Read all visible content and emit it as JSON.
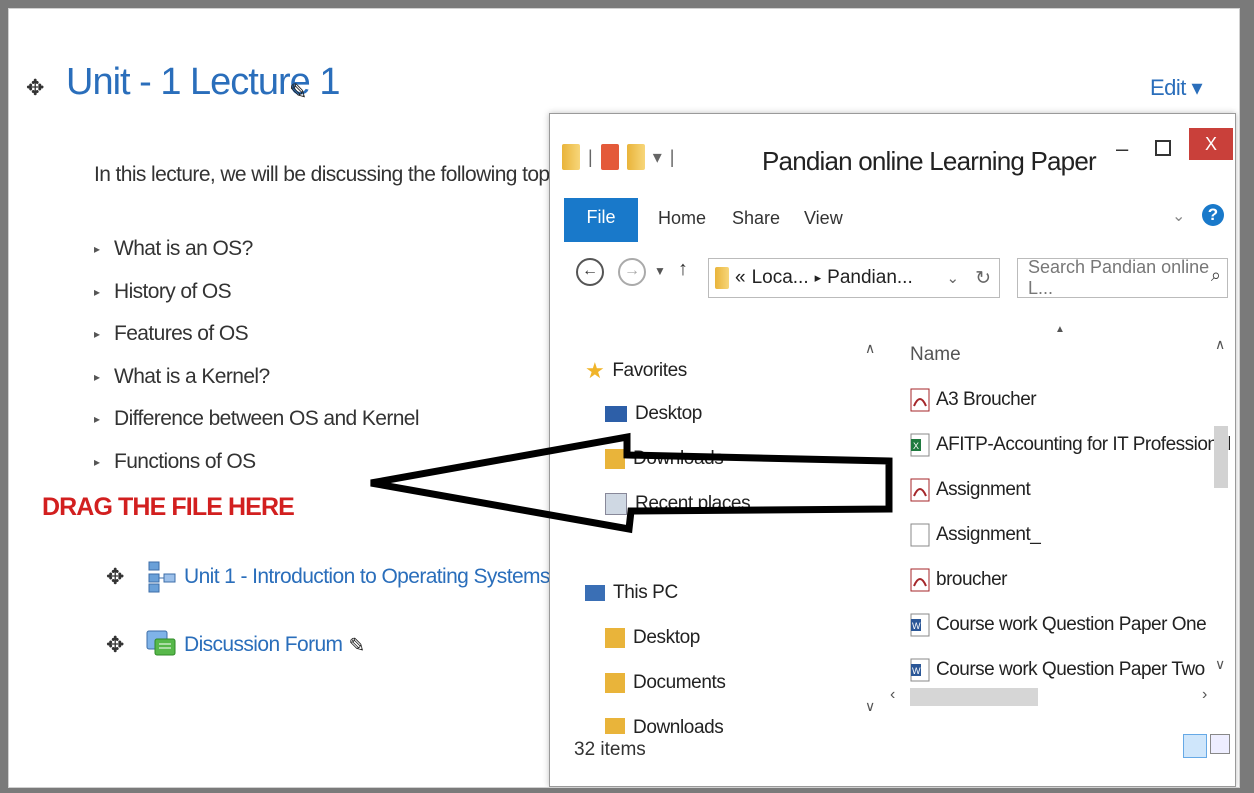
{
  "course": {
    "title": "Unit - 1 Lecture 1",
    "edit_label": "Edit ▾",
    "intro": "In this lecture, we will be discussing the following topics.",
    "topics": [
      "What is an OS?",
      "History of OS",
      "Features of OS",
      "What is a Kernel?",
      "Difference between OS and Kernel",
      "Functions of OS"
    ],
    "drag_hint": "DRAG THE FILE HERE",
    "activities": [
      {
        "label": "Unit 1 - Introduction to Operating Systems",
        "icon": "diagram-icon"
      },
      {
        "label": "Discussion Forum",
        "icon": "forum-icon"
      }
    ]
  },
  "explorer": {
    "title": "Pandian online Learning Paper",
    "close_label": "X",
    "ribbon_tabs": [
      "File",
      "Home",
      "Share",
      "View"
    ],
    "address_parts": [
      "«",
      "Loca...",
      "▸",
      "Pandian..."
    ],
    "search_placeholder": "Search Pandian online L...",
    "nav_items": {
      "favorites": "Favorites",
      "desktop": "Desktop",
      "downloads": "Downloads",
      "recent": "Recent places",
      "this_pc": "This PC",
      "pc_desktop": "Desktop",
      "documents": "Documents",
      "pc_downloads": "Downloads"
    },
    "column_name": "Name",
    "files": [
      {
        "name": "A3 Broucher",
        "type": "pdf"
      },
      {
        "name": "AFITP-Accounting for IT Professionals - ...",
        "type": "excel"
      },
      {
        "name": "Assignment",
        "type": "pdf"
      },
      {
        "name": "Assignment_",
        "type": "blank"
      },
      {
        "name": "broucher",
        "type": "pdf"
      },
      {
        "name": "Course work Question Paper One",
        "type": "word"
      },
      {
        "name": "Course work Question Paper Two",
        "type": "word"
      }
    ],
    "status": "32 items"
  },
  "colors": {
    "link_blue": "#2a6ebb",
    "hint_red": "#d21f1f",
    "file_tab_blue": "#1979ca",
    "close_red": "#c9403a"
  }
}
